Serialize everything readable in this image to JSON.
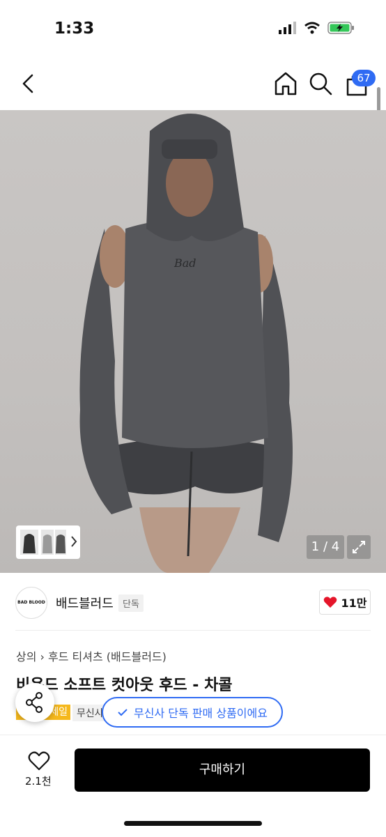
{
  "status": {
    "time": "1:33"
  },
  "nav": {
    "cart_count": "67",
    "icons": [
      "back-chevron-icon",
      "home-icon",
      "search-icon",
      "shopping-bag-icon"
    ]
  },
  "gallery": {
    "counter": "1 / 4"
  },
  "brand": {
    "name": "배드블러드",
    "tag": "단독",
    "logo_text": "BAD BLOOD",
    "likes": "11만"
  },
  "product": {
    "breadcrumb": [
      "상의",
      "후드 티셔츠 (배드블러드)"
    ],
    "title": "비욘드 소프트 컷아웃 후드 - 차콜",
    "sale_badge": "세일",
    "musinsa_label": "무신사",
    "toast": "무신사 단독 판매 상품이에요"
  },
  "bottom": {
    "wish_count": "2.1천",
    "buy_label": "구매하기"
  },
  "colors": {
    "accent": "#2f6bf3",
    "heart": "#e5152a",
    "sale": "#f5b81c"
  }
}
